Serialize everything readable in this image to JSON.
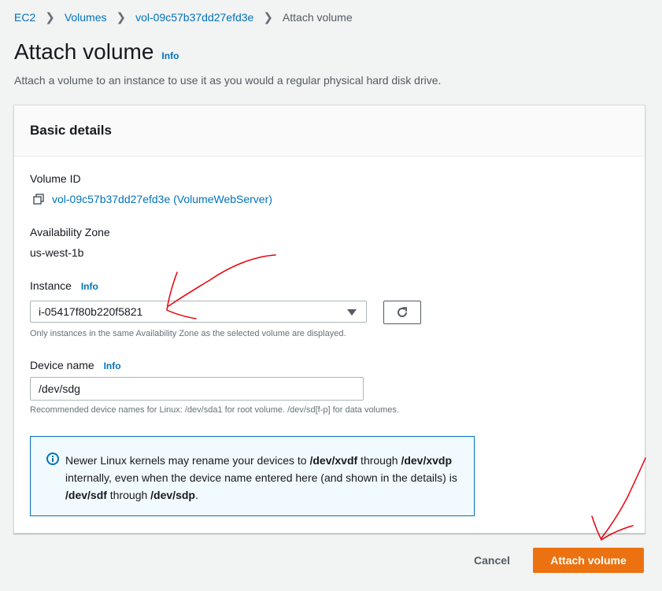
{
  "breadcrumb": {
    "items": [
      "EC2",
      "Volumes",
      "vol-09c57b37dd27efd3e"
    ],
    "current": "Attach volume"
  },
  "header": {
    "title": "Attach volume",
    "info": "Info",
    "description": "Attach a volume to an instance to use it as you would a regular physical hard disk drive."
  },
  "panel": {
    "title": "Basic details",
    "volume_id": {
      "label": "Volume ID",
      "value": "vol-09c57b37dd27efd3e (VolumeWebServer)",
      "icon": "copy-icon"
    },
    "availability_zone": {
      "label": "Availability Zone",
      "value": "us-west-1b"
    },
    "instance": {
      "label": "Instance",
      "info": "Info",
      "value": "i-05417f80b220f5821",
      "hint": "Only instances in the same Availability Zone as the selected volume are displayed."
    },
    "device_name": {
      "label": "Device name",
      "info": "Info",
      "value": "/dev/sdg",
      "hint": "Recommended device names for Linux: /dev/sda1 for root volume. /dev/sd[f-p] for data volumes."
    },
    "alert": {
      "text_1": "Newer Linux kernels may rename your devices to ",
      "bold_1": "/dev/xvdf",
      "text_2": " through ",
      "bold_2": "/dev/xvdp",
      "text_3": " internally, even when the device name entered here (and shown in the details) is ",
      "bold_3": "/dev/sdf",
      "text_4": " through ",
      "bold_4": "/dev/sdp",
      "text_5": "."
    }
  },
  "footer": {
    "cancel_label": "Cancel",
    "attach_label": "Attach volume"
  },
  "colors": {
    "link": "#0073bb",
    "primary": "#ec7211",
    "annotation": "#e8000b"
  }
}
